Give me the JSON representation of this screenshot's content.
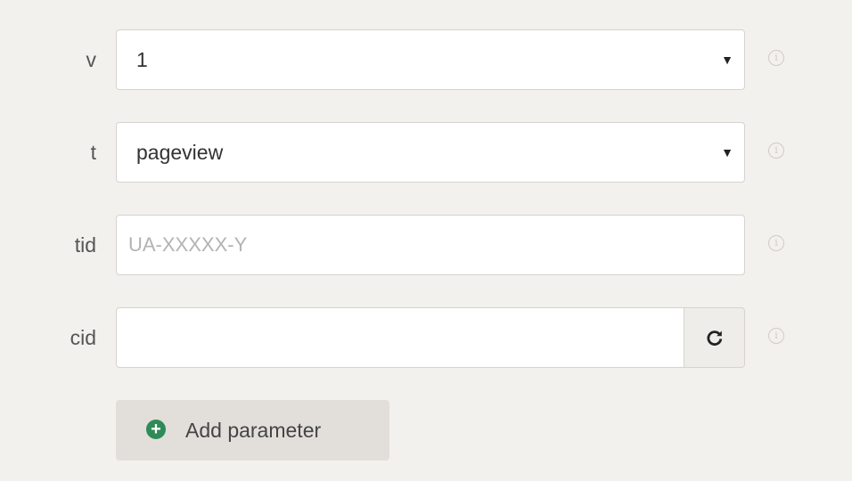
{
  "rows": [
    {
      "label": "v",
      "type": "select",
      "value": "1"
    },
    {
      "label": "t",
      "type": "select",
      "value": "pageview"
    },
    {
      "label": "tid",
      "type": "text",
      "value": "",
      "placeholder": "UA-XXXXX-Y"
    },
    {
      "label": "cid",
      "type": "text-with-button",
      "value": "",
      "button_icon": "refresh-icon",
      "button_glyph": "C"
    }
  ],
  "caret_glyph": "▼",
  "info_glyph": "i",
  "info_icon": "info-circle-icon",
  "add_parameter": {
    "label": "Add parameter",
    "icon": "plus-circle-icon",
    "glyph": "+"
  },
  "colors": {
    "background": "#f3f1ee",
    "add_icon": "#2e8b57"
  }
}
